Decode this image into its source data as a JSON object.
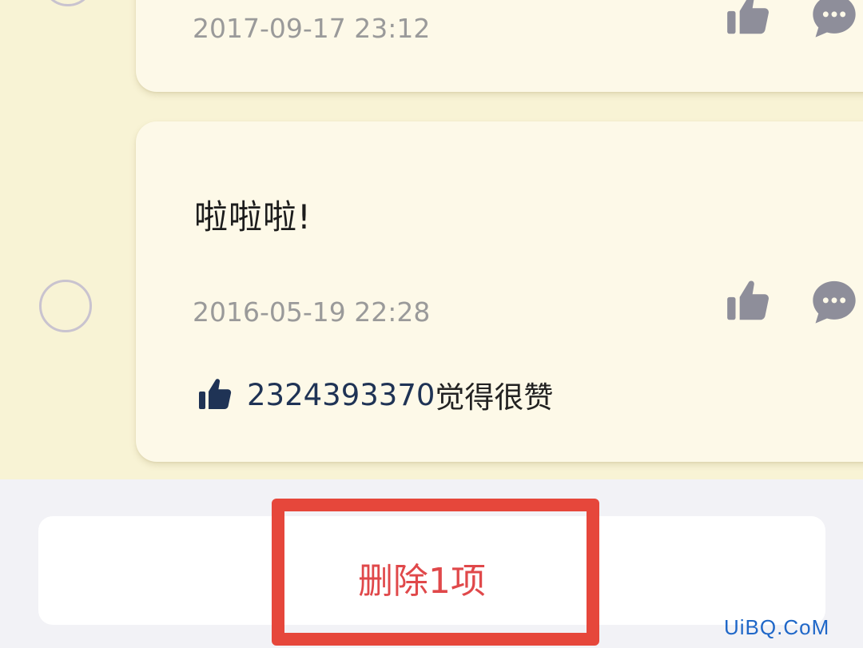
{
  "posts": [
    {
      "timestamp": "2017-09-17 23:12",
      "like_icon": "thumbs-up-icon",
      "comment_icon": "comment-bubble-icon"
    },
    {
      "text": "啦啦啦!",
      "timestamp": "2016-05-19 22:28",
      "like_icon": "thumbs-up-icon",
      "comment_icon": "comment-bubble-icon",
      "likes": {
        "icon": "thumbs-up-icon",
        "user": "2324393370",
        "suffix": "觉得很赞"
      }
    }
  ],
  "toolbar": {
    "delete_label": "删除1项"
  },
  "watermark": "UiBQ.CoM",
  "colors": {
    "background": "#f8f3d5",
    "card": "#fdf9e8",
    "icon_gray": "#8e8e9a",
    "likes_user": "#1f3355",
    "delete_text": "#e0484a",
    "highlight_box": "#e6473b",
    "watermark": "#1f67c8"
  }
}
